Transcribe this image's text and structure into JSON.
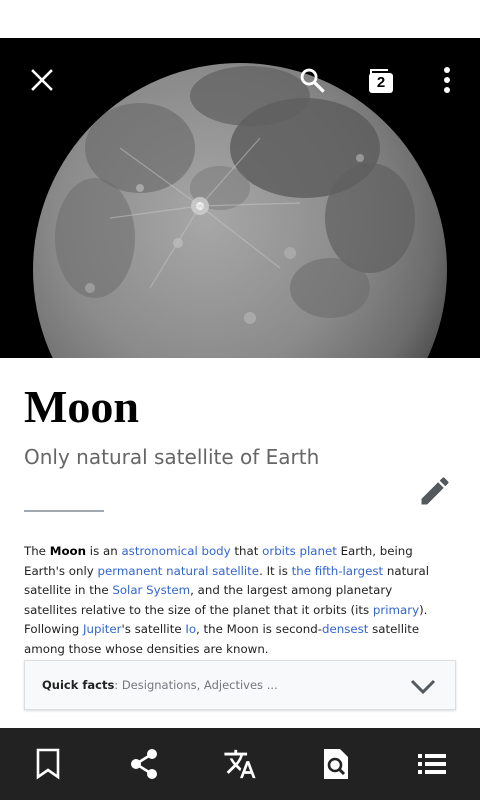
{
  "toolbar": {
    "close_icon": "close-icon",
    "search_icon": "search-icon",
    "tabs_icon": "tabs-icon",
    "tabs_count": "2",
    "overflow_icon": "more-vert-icon"
  },
  "hero": {
    "image_subject": "moon-image",
    "background_color": "#000000"
  },
  "article": {
    "title": "Moon",
    "description": "Only natural satellite of Earth",
    "edit_icon": "edit-pencil-icon",
    "lead": {
      "t1": "The ",
      "bold": "Moon",
      "t2": " is an ",
      "l1": "astronomical body",
      "t3": " that ",
      "l2": "orbits planet",
      "t4": " Earth, being Earth's only ",
      "l3": "permanent natural satellite",
      "t5": ". It is ",
      "l4": "the fifth-largest",
      "t6": " natural satellite in the ",
      "l5": "Solar System",
      "t7": ", and the largest among planetary satellites relative to the size of the planet that it orbits (its ",
      "l6": "primary",
      "t8": "). Following ",
      "l7": "Jupiter",
      "t9": "'s satellite ",
      "l8": "Io",
      "t10": ", the Moon is second-",
      "l9": "densest",
      "t11": " satellite among those whose densities are known."
    },
    "link_color": "#3366cc"
  },
  "quick_facts": {
    "label": "Quick facts",
    "separator": ": ",
    "summary": "Designations, Adjectives ...",
    "chevron_icon": "chevron-down-icon"
  },
  "bottom_bar": {
    "background": "#222222",
    "items": [
      {
        "icon": "bookmark-icon"
      },
      {
        "icon": "share-icon"
      },
      {
        "icon": "translate-icon"
      },
      {
        "icon": "find-in-page-icon"
      },
      {
        "icon": "contents-list-icon"
      }
    ]
  }
}
